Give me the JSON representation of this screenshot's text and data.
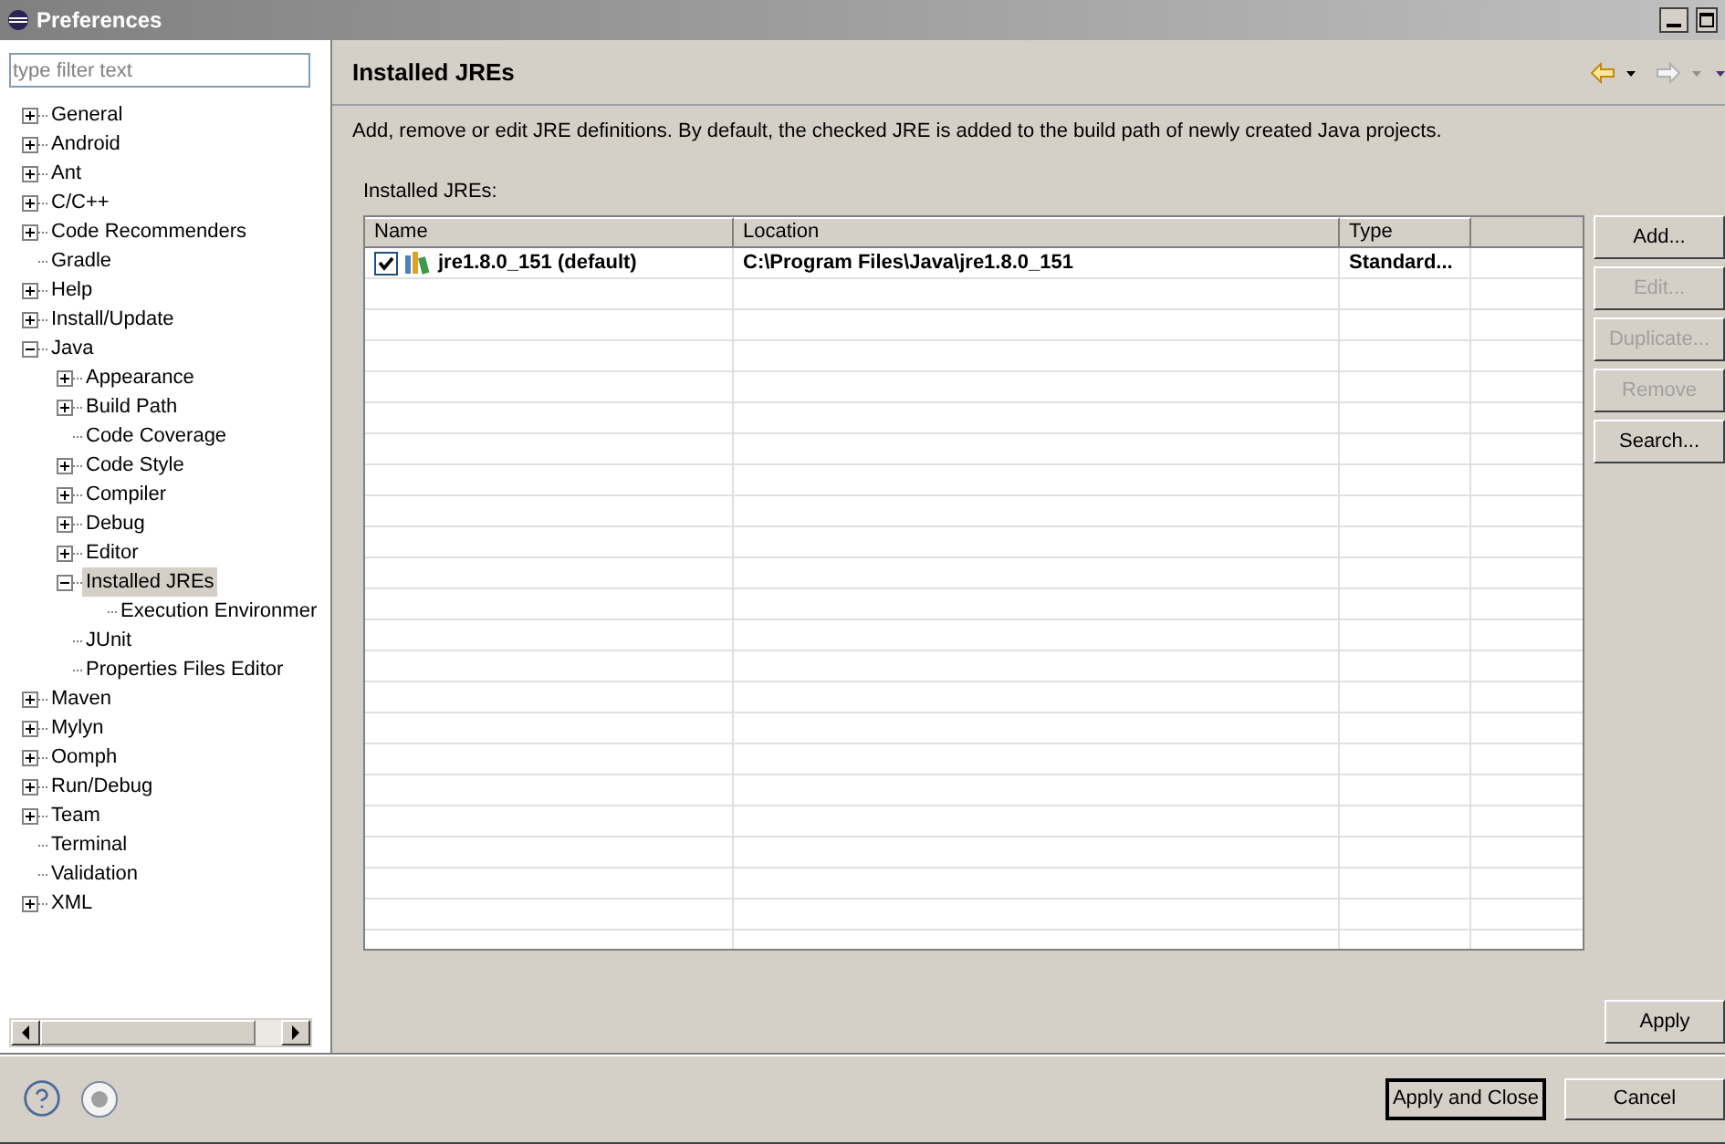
{
  "window": {
    "title": "Preferences"
  },
  "filter": {
    "placeholder": "type filter text"
  },
  "tree": [
    {
      "label": "General",
      "kind": "branch",
      "expanded": false,
      "selected": false
    },
    {
      "label": "Android",
      "kind": "branch",
      "expanded": false,
      "selected": false
    },
    {
      "label": "Ant",
      "kind": "branch",
      "expanded": false,
      "selected": false
    },
    {
      "label": "C/C++",
      "kind": "branch",
      "expanded": false,
      "selected": false
    },
    {
      "label": "Code Recommenders",
      "kind": "branch",
      "expanded": false,
      "selected": false
    },
    {
      "label": "Gradle",
      "kind": "leaf",
      "selected": false
    },
    {
      "label": "Help",
      "kind": "branch",
      "expanded": false,
      "selected": false
    },
    {
      "label": "Install/Update",
      "kind": "branch",
      "expanded": false,
      "selected": false
    },
    {
      "label": "Java",
      "kind": "branch",
      "expanded": true,
      "selected": false,
      "children": [
        {
          "label": "Appearance",
          "kind": "branch",
          "expanded": false,
          "selected": false
        },
        {
          "label": "Build Path",
          "kind": "branch",
          "expanded": false,
          "selected": false
        },
        {
          "label": "Code Coverage",
          "kind": "leaf",
          "selected": false
        },
        {
          "label": "Code Style",
          "kind": "branch",
          "expanded": false,
          "selected": false
        },
        {
          "label": "Compiler",
          "kind": "branch",
          "expanded": false,
          "selected": false
        },
        {
          "label": "Debug",
          "kind": "branch",
          "expanded": false,
          "selected": false
        },
        {
          "label": "Editor",
          "kind": "branch",
          "expanded": false,
          "selected": false
        },
        {
          "label": "Installed JREs",
          "kind": "branch",
          "expanded": true,
          "selected": true,
          "children": [
            {
              "label": "Execution Environmer",
              "kind": "leaf",
              "selected": false
            }
          ]
        },
        {
          "label": "JUnit",
          "kind": "leaf",
          "selected": false
        },
        {
          "label": "Properties Files Editor",
          "kind": "leaf",
          "selected": false
        }
      ]
    },
    {
      "label": "Maven",
      "kind": "branch",
      "expanded": false,
      "selected": false
    },
    {
      "label": "Mylyn",
      "kind": "branch",
      "expanded": false,
      "selected": false
    },
    {
      "label": "Oomph",
      "kind": "branch",
      "expanded": false,
      "selected": false
    },
    {
      "label": "Run/Debug",
      "kind": "branch",
      "expanded": false,
      "selected": false
    },
    {
      "label": "Team",
      "kind": "branch",
      "expanded": false,
      "selected": false
    },
    {
      "label": "Terminal",
      "kind": "leaf",
      "selected": false
    },
    {
      "label": "Validation",
      "kind": "leaf",
      "selected": false
    },
    {
      "label": "XML",
      "kind": "branch",
      "expanded": false,
      "selected": false
    }
  ],
  "page": {
    "title": "Installed JREs",
    "description": "Add, remove or edit JRE definitions. By default, the checked JRE is added to the build path of newly created Java projects.",
    "table_label": "Installed JREs:",
    "table": {
      "columns": [
        "Name",
        "Location",
        "Type"
      ],
      "rows": [
        {
          "checked": true,
          "name": "jre1.8.0_151 (default)",
          "location": "C:\\Program Files\\Java\\jre1.8.0_151",
          "type": "Standard..."
        }
      ]
    },
    "buttons": [
      {
        "label": "Add...",
        "disabled": false
      },
      {
        "label": "Edit...",
        "disabled": true
      },
      {
        "label": "Duplicate...",
        "disabled": true
      },
      {
        "label": "Remove",
        "disabled": true
      },
      {
        "label": "Search...",
        "disabled": false
      }
    ],
    "apply": "Apply"
  },
  "footer": {
    "buttons": [
      {
        "label": "Apply and Close",
        "default": true
      },
      {
        "label": "Cancel",
        "default": false
      }
    ]
  }
}
